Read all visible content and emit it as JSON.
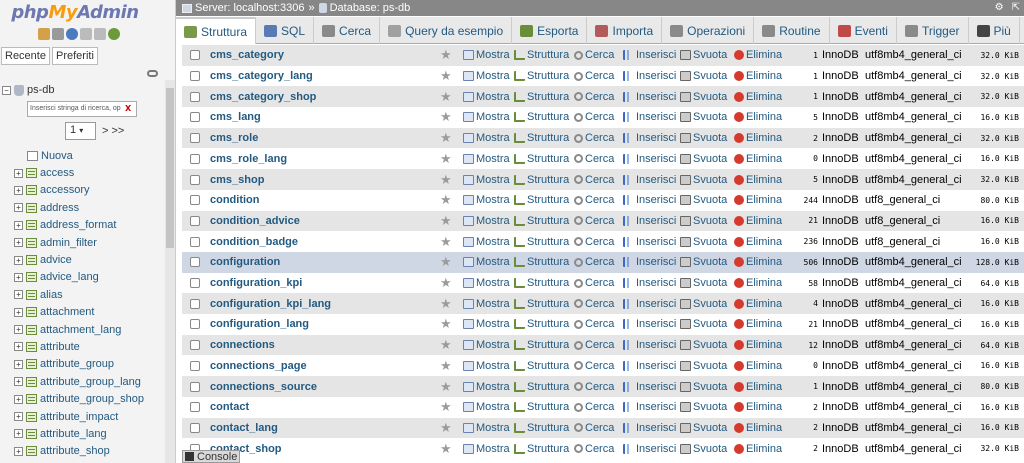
{
  "sidebar": {
    "logo_php": "php",
    "logo_my": "My",
    "logo_admin": "Admin",
    "recent_label": "Recente",
    "favorites_label": "Preferiti",
    "db_name": "ps-db",
    "search_placeholder": "Inserisci stringa di ricerca, op",
    "search_clear": "X",
    "page_value": "1",
    "page_next": "> >>",
    "new_label": "Nuova",
    "tables": [
      "access",
      "accessory",
      "address",
      "address_format",
      "admin_filter",
      "advice",
      "advice_lang",
      "alias",
      "attachment",
      "attachment_lang",
      "attribute",
      "attribute_group",
      "attribute_group_lang",
      "attribute_group_shop",
      "attribute_impact",
      "attribute_lang",
      "attribute_shop"
    ]
  },
  "topbar": {
    "server": "Server: localhost:3306",
    "separator": "»",
    "database": "Database: ps-db"
  },
  "tabs": [
    {
      "label": "Struttura",
      "color": "#7a9a4a"
    },
    {
      "label": "SQL",
      "color": "#5a7ab5"
    },
    {
      "label": "Cerca",
      "color": "#8a8a8a"
    },
    {
      "label": "Query da esempio",
      "color": "#a0a0a0"
    },
    {
      "label": "Esporta",
      "color": "#6a8d3a"
    },
    {
      "label": "Importa",
      "color": "#b55a5a"
    },
    {
      "label": "Operazioni",
      "color": "#8a8a8a"
    },
    {
      "label": "Routine",
      "color": "#8a8a8a"
    },
    {
      "label": "Eventi",
      "color": "#c04a4a"
    },
    {
      "label": "Trigger",
      "color": "#8a8a8a"
    },
    {
      "label": "Più",
      "color": "#444444"
    }
  ],
  "actions": {
    "browse": "Mostra",
    "structure": "Struttura",
    "search": "Cerca",
    "insert": "Inserisci",
    "empty": "Svuota",
    "drop": "Elimina"
  },
  "rows": [
    {
      "name": "cms_category",
      "count": "1",
      "engine": "InnoDB",
      "collation": "utf8mb4_general_ci",
      "size": "32.0 KiB"
    },
    {
      "name": "cms_category_lang",
      "count": "1",
      "engine": "InnoDB",
      "collation": "utf8mb4_general_ci",
      "size": "32.0 KiB"
    },
    {
      "name": "cms_category_shop",
      "count": "1",
      "engine": "InnoDB",
      "collation": "utf8mb4_general_ci",
      "size": "32.0 KiB"
    },
    {
      "name": "cms_lang",
      "count": "5",
      "engine": "InnoDB",
      "collation": "utf8mb4_general_ci",
      "size": "16.0 KiB"
    },
    {
      "name": "cms_role",
      "count": "2",
      "engine": "InnoDB",
      "collation": "utf8mb4_general_ci",
      "size": "32.0 KiB"
    },
    {
      "name": "cms_role_lang",
      "count": "0",
      "engine": "InnoDB",
      "collation": "utf8mb4_general_ci",
      "size": "16.0 KiB"
    },
    {
      "name": "cms_shop",
      "count": "5",
      "engine": "InnoDB",
      "collation": "utf8mb4_general_ci",
      "size": "32.0 KiB"
    },
    {
      "name": "condition",
      "count": "244",
      "engine": "InnoDB",
      "collation": "utf8_general_ci",
      "size": "80.0 KiB"
    },
    {
      "name": "condition_advice",
      "count": "21",
      "engine": "InnoDB",
      "collation": "utf8_general_ci",
      "size": "16.0 KiB"
    },
    {
      "name": "condition_badge",
      "count": "236",
      "engine": "InnoDB",
      "collation": "utf8_general_ci",
      "size": "16.0 KiB"
    },
    {
      "name": "configuration",
      "count": "506",
      "engine": "InnoDB",
      "collation": "utf8mb4_general_ci",
      "size": "128.0 KiB"
    },
    {
      "name": "configuration_kpi",
      "count": "58",
      "engine": "InnoDB",
      "collation": "utf8mb4_general_ci",
      "size": "64.0 KiB"
    },
    {
      "name": "configuration_kpi_lang",
      "count": "4",
      "engine": "InnoDB",
      "collation": "utf8mb4_general_ci",
      "size": "16.0 KiB"
    },
    {
      "name": "configuration_lang",
      "count": "21",
      "engine": "InnoDB",
      "collation": "utf8mb4_general_ci",
      "size": "16.0 KiB"
    },
    {
      "name": "connections",
      "count": "12",
      "engine": "InnoDB",
      "collation": "utf8mb4_general_ci",
      "size": "64.0 KiB"
    },
    {
      "name": "connections_page",
      "count": "0",
      "engine": "InnoDB",
      "collation": "utf8mb4_general_ci",
      "size": "16.0 KiB"
    },
    {
      "name": "connections_source",
      "count": "1",
      "engine": "InnoDB",
      "collation": "utf8mb4_general_ci",
      "size": "80.0 KiB"
    },
    {
      "name": "contact",
      "count": "2",
      "engine": "InnoDB",
      "collation": "utf8mb4_general_ci",
      "size": "16.0 KiB"
    },
    {
      "name": "contact_lang",
      "count": "2",
      "engine": "InnoDB",
      "collation": "utf8mb4_general_ci",
      "size": "16.0 KiB"
    },
    {
      "name": "contact_shop",
      "count": "2",
      "engine": "InnoDB",
      "collation": "utf8mb4_general_ci",
      "size": "32.0 KiB"
    }
  ],
  "console_label": "Console"
}
